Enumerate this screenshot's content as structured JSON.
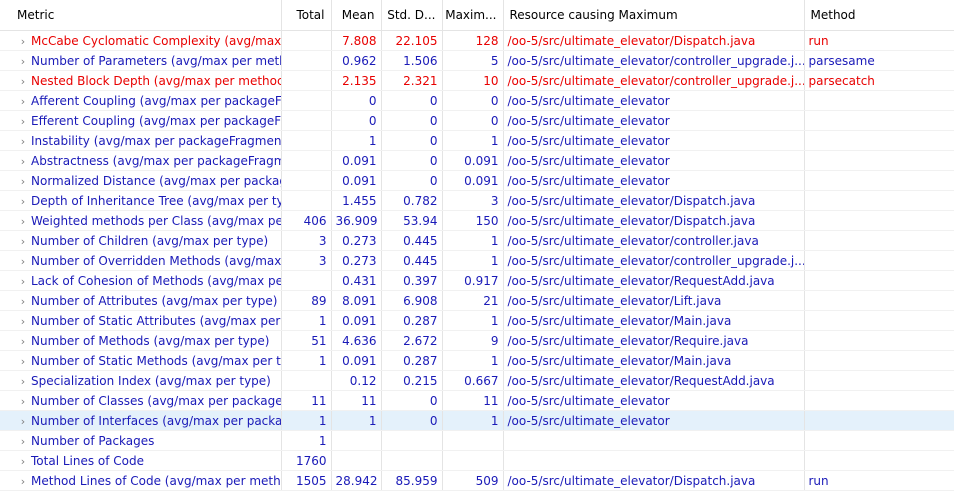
{
  "columns": [
    "Metric",
    "Total",
    "Mean",
    "Std. D...",
    "Maxim...",
    "Resource causing Maximum",
    "Method"
  ],
  "expander_icon": "chevron-right-icon",
  "colors": {
    "normal": "#1a1ab8",
    "warning": "#e80000",
    "selected_row": "#e4f1fb"
  },
  "rows": [
    {
      "metric": "McCabe Cyclomatic Complexity (avg/max",
      "total": "",
      "mean": "7.808",
      "std": "22.105",
      "max": "128",
      "resource": "/oo-5/src/ultimate_elevator/Dispatch.java",
      "method": "run",
      "status": "warning"
    },
    {
      "metric": "Number of Parameters (avg/max per meth",
      "total": "",
      "mean": "0.962",
      "std": "1.506",
      "max": "5",
      "resource": "/oo-5/src/ultimate_elevator/controller_upgrade.j...",
      "method": "parsesame",
      "status": "normal"
    },
    {
      "metric": "Nested Block Depth (avg/max per methoc",
      "total": "",
      "mean": "2.135",
      "std": "2.321",
      "max": "10",
      "resource": "/oo-5/src/ultimate_elevator/controller_upgrade.j...",
      "method": "parsecatch",
      "status": "warning"
    },
    {
      "metric": "Afferent Coupling (avg/max per packageF",
      "total": "",
      "mean": "0",
      "std": "0",
      "max": "0",
      "resource": "/oo-5/src/ultimate_elevator",
      "method": "",
      "status": "normal"
    },
    {
      "metric": "Efferent Coupling (avg/max per packageFi",
      "total": "",
      "mean": "0",
      "std": "0",
      "max": "0",
      "resource": "/oo-5/src/ultimate_elevator",
      "method": "",
      "status": "normal"
    },
    {
      "metric": "Instability (avg/max per packageFragment",
      "total": "",
      "mean": "1",
      "std": "0",
      "max": "1",
      "resource": "/oo-5/src/ultimate_elevator",
      "method": "",
      "status": "normal"
    },
    {
      "metric": "Abstractness (avg/max per packageFragm",
      "total": "",
      "mean": "0.091",
      "std": "0",
      "max": "0.091",
      "resource": "/oo-5/src/ultimate_elevator",
      "method": "",
      "status": "normal"
    },
    {
      "metric": "Normalized Distance (avg/max per packag",
      "total": "",
      "mean": "0.091",
      "std": "0",
      "max": "0.091",
      "resource": "/oo-5/src/ultimate_elevator",
      "method": "",
      "status": "normal"
    },
    {
      "metric": "Depth of Inheritance Tree (avg/max per ty",
      "total": "",
      "mean": "1.455",
      "std": "0.782",
      "max": "3",
      "resource": "/oo-5/src/ultimate_elevator/Dispatch.java",
      "method": "",
      "status": "normal"
    },
    {
      "metric": "Weighted methods per Class (avg/max pe",
      "total": "406",
      "mean": "36.909",
      "std": "53.94",
      "max": "150",
      "resource": "/oo-5/src/ultimate_elevator/Dispatch.java",
      "method": "",
      "status": "normal"
    },
    {
      "metric": "Number of Children (avg/max per type)",
      "total": "3",
      "mean": "0.273",
      "std": "0.445",
      "max": "1",
      "resource": "/oo-5/src/ultimate_elevator/controller.java",
      "method": "",
      "status": "normal"
    },
    {
      "metric": "Number of Overridden Methods (avg/max",
      "total": "3",
      "mean": "0.273",
      "std": "0.445",
      "max": "1",
      "resource": "/oo-5/src/ultimate_elevator/controller_upgrade.j...",
      "method": "",
      "status": "normal"
    },
    {
      "metric": "Lack of Cohesion of Methods (avg/max pe",
      "total": "",
      "mean": "0.431",
      "std": "0.397",
      "max": "0.917",
      "resource": "/oo-5/src/ultimate_elevator/RequestAdd.java",
      "method": "",
      "status": "normal"
    },
    {
      "metric": "Number of Attributes (avg/max per type)",
      "total": "89",
      "mean": "8.091",
      "std": "6.908",
      "max": "21",
      "resource": "/oo-5/src/ultimate_elevator/Lift.java",
      "method": "",
      "status": "normal"
    },
    {
      "metric": "Number of Static Attributes (avg/max per",
      "total": "1",
      "mean": "0.091",
      "std": "0.287",
      "max": "1",
      "resource": "/oo-5/src/ultimate_elevator/Main.java",
      "method": "",
      "status": "normal"
    },
    {
      "metric": "Number of Methods (avg/max per type)",
      "total": "51",
      "mean": "4.636",
      "std": "2.672",
      "max": "9",
      "resource": "/oo-5/src/ultimate_elevator/Require.java",
      "method": "",
      "status": "normal"
    },
    {
      "metric": "Number of Static Methods (avg/max per t",
      "total": "1",
      "mean": "0.091",
      "std": "0.287",
      "max": "1",
      "resource": "/oo-5/src/ultimate_elevator/Main.java",
      "method": "",
      "status": "normal"
    },
    {
      "metric": "Specialization Index (avg/max per type)",
      "total": "",
      "mean": "0.12",
      "std": "0.215",
      "max": "0.667",
      "resource": "/oo-5/src/ultimate_elevator/RequestAdd.java",
      "method": "",
      "status": "normal"
    },
    {
      "metric": "Number of Classes (avg/max per package",
      "total": "11",
      "mean": "11",
      "std": "0",
      "max": "11",
      "resource": "/oo-5/src/ultimate_elevator",
      "method": "",
      "status": "normal"
    },
    {
      "metric": "Number of Interfaces (avg/max per packa",
      "total": "1",
      "mean": "1",
      "std": "0",
      "max": "1",
      "resource": "/oo-5/src/ultimate_elevator",
      "method": "",
      "status": "selected"
    },
    {
      "metric": "Number of Packages",
      "total": "1",
      "mean": "",
      "std": "",
      "max": "",
      "resource": "",
      "method": "",
      "status": "normal"
    },
    {
      "metric": "Total Lines of Code",
      "total": "1760",
      "mean": "",
      "std": "",
      "max": "",
      "resource": "",
      "method": "",
      "status": "normal"
    },
    {
      "metric": "Method Lines of Code (avg/max per meth",
      "total": "1505",
      "mean": "28.942",
      "std": "85.959",
      "max": "509",
      "resource": "/oo-5/src/ultimate_elevator/Dispatch.java",
      "method": "run",
      "status": "normal"
    }
  ]
}
